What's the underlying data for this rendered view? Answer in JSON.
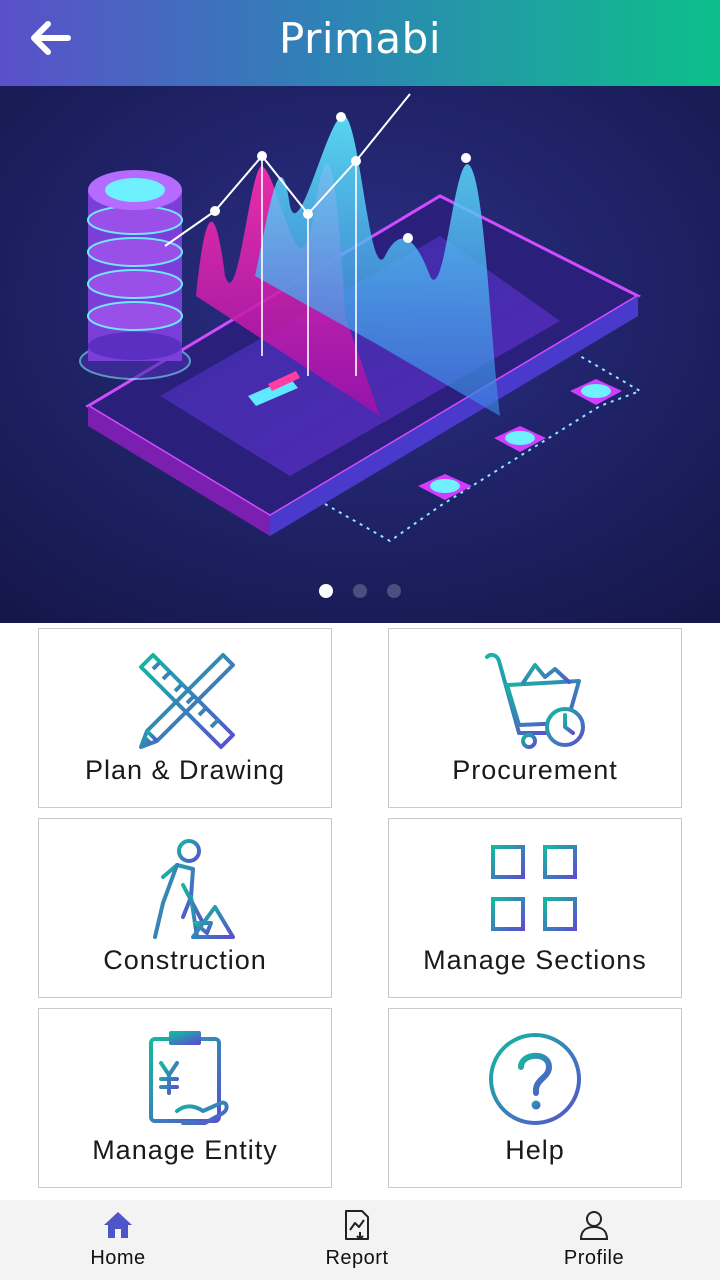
{
  "header": {
    "logo_text": "Primabi",
    "back_icon": "arrow-left-icon"
  },
  "banner": {
    "slides": 3,
    "active_slide": 1
  },
  "tiles": [
    {
      "label": "Plan & Drawing",
      "icon": "ruler-pencil-icon"
    },
    {
      "label": "Procurement",
      "icon": "shopping-cart-clock-icon"
    },
    {
      "label": "Construction",
      "icon": "worker-shovel-icon"
    },
    {
      "label": "Manage Sections",
      "icon": "sections-grid-icon"
    },
    {
      "label": "Manage Entity",
      "icon": "clipboard-yen-icon"
    },
    {
      "label": "Help",
      "icon": "question-circle-icon"
    }
  ],
  "bottom_nav": [
    {
      "label": "Home",
      "icon": "home-icon",
      "active": true
    },
    {
      "label": "Report",
      "icon": "report-icon",
      "active": false
    },
    {
      "label": "Profile",
      "icon": "user-icon",
      "active": false
    }
  ],
  "colors": {
    "header_start": "#5b50c9",
    "header_end": "#0cc08a",
    "icon_teal": "#1bb3a0",
    "icon_indigo": "#5a4fcf",
    "banner_bg": "#1d1f5e"
  }
}
